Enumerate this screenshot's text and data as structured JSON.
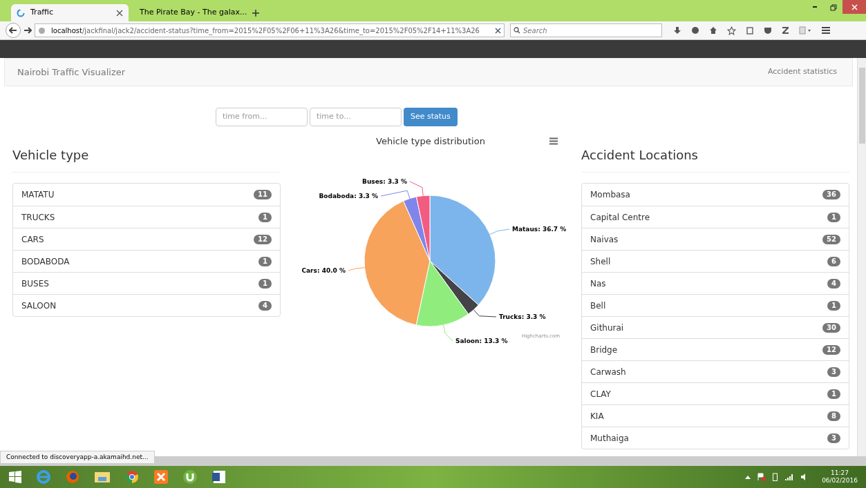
{
  "browser": {
    "tabs": [
      {
        "title": "Traffic",
        "selected": true
      },
      {
        "title": "The Pirate Bay - The galax...",
        "selected": false
      }
    ],
    "url_host": "localhost",
    "url_path": "/jackfinal/jack2/accident-status?time_from=2015%2F05%2F06+11%3A26&time_to=2015%2F05%2F14+11%3A26",
    "search_placeholder": "Search",
    "status_text": "Connected to discoveryapp-a.akamaihd.net..."
  },
  "navbar": {
    "brand": "Nairobi Traffic Visualizer",
    "link": "Accident statistics"
  },
  "filter": {
    "from_placeholder": "time from...",
    "to_placeholder": "time to...",
    "button": "See status"
  },
  "vehicle_types": {
    "heading": "Vehicle type",
    "items": [
      {
        "name": "MATATU",
        "count": "11"
      },
      {
        "name": "TRUCKS",
        "count": "1"
      },
      {
        "name": "CARS",
        "count": "12"
      },
      {
        "name": "BODABODA",
        "count": "1"
      },
      {
        "name": "BUSES",
        "count": "1"
      },
      {
        "name": "SALOON",
        "count": "4"
      }
    ]
  },
  "chart": {
    "credit": "Highcharts.com",
    "chart_data": {
      "type": "pie",
      "title": "Vehicle type distribution",
      "values": [
        36.7,
        3.3,
        13.3,
        40.0,
        3.3,
        3.3
      ],
      "value_labels": [
        "Mataus: 36.7 %",
        "Trucks: 3.3 %",
        "Saloon: 13.3 %",
        "Cars: 40.0 %",
        "Bodaboda: 3.3 %",
        "Buses: 3.3 %"
      ],
      "colors": [
        "#7cb5ec",
        "#434348",
        "#90ed7d",
        "#f7a35c",
        "#8085e9",
        "#f15c80"
      ]
    }
  },
  "locations": {
    "heading": "Accident Locations",
    "items": [
      {
        "name": "Mombasa",
        "count": "36"
      },
      {
        "name": "Capital Centre",
        "count": "1"
      },
      {
        "name": "Naivas",
        "count": "52"
      },
      {
        "name": "Shell",
        "count": "6"
      },
      {
        "name": "Nas",
        "count": "4"
      },
      {
        "name": "Bell",
        "count": "1"
      },
      {
        "name": "Githurai",
        "count": "30"
      },
      {
        "name": "Bridge",
        "count": "12"
      },
      {
        "name": "Carwash",
        "count": "3"
      },
      {
        "name": "CLAY",
        "count": "1"
      },
      {
        "name": "KIA",
        "count": "8"
      },
      {
        "name": "Muthaiga",
        "count": "3"
      }
    ]
  },
  "taskbar": {
    "time": "11:27",
    "date": "06/02/2016"
  }
}
